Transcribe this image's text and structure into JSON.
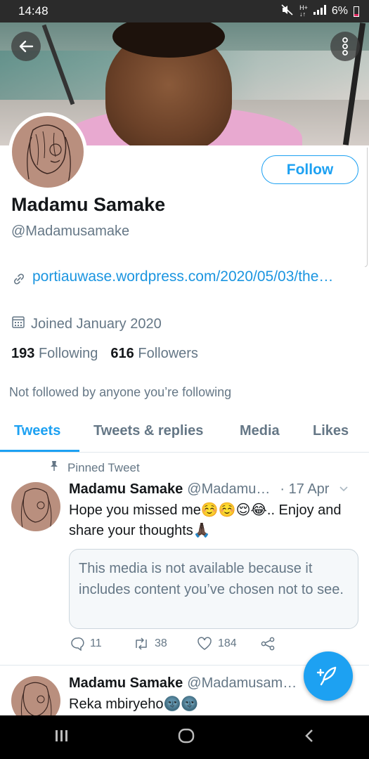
{
  "status_bar": {
    "time": "14:48",
    "battery": "6%"
  },
  "profile": {
    "follow_label": "Follow",
    "name": "Madamu Samake",
    "handle": "@Madamusamake",
    "website": "portiauwase.wordpress.com/2020/05/03/the…",
    "joined": "Joined January 2020",
    "following_count": "193",
    "following_label": "Following",
    "followers_count": "616",
    "followers_label": "Followers",
    "not_followed": "Not followed by anyone you’re following"
  },
  "tabs": [
    {
      "label": "Tweets",
      "active": true
    },
    {
      "label": "Tweets & replies",
      "active": false
    },
    {
      "label": "Media",
      "active": false
    },
    {
      "label": "Likes",
      "active": false
    }
  ],
  "tweets": [
    {
      "pinned_label": "Pinned Tweet",
      "author": "Madamu Samake",
      "handle": "@Madamu…",
      "date": "· 17 Apr",
      "text": "Hope you missed me☺️☺️😌😂.. Enjoy and share your thoughts🙏🏿",
      "media_notice": "This media is not available because it includes content you’ve chosen not to see.",
      "replies": "11",
      "retweets": "38",
      "likes": "184"
    },
    {
      "author": "Madamu Samake",
      "handle": "@Madamusam…",
      "text": "Reka mbiryeho🌚🌚"
    }
  ],
  "colors": {
    "accent": "#1da1f2",
    "secondary_text": "#657786",
    "link": "#1b95e0"
  }
}
